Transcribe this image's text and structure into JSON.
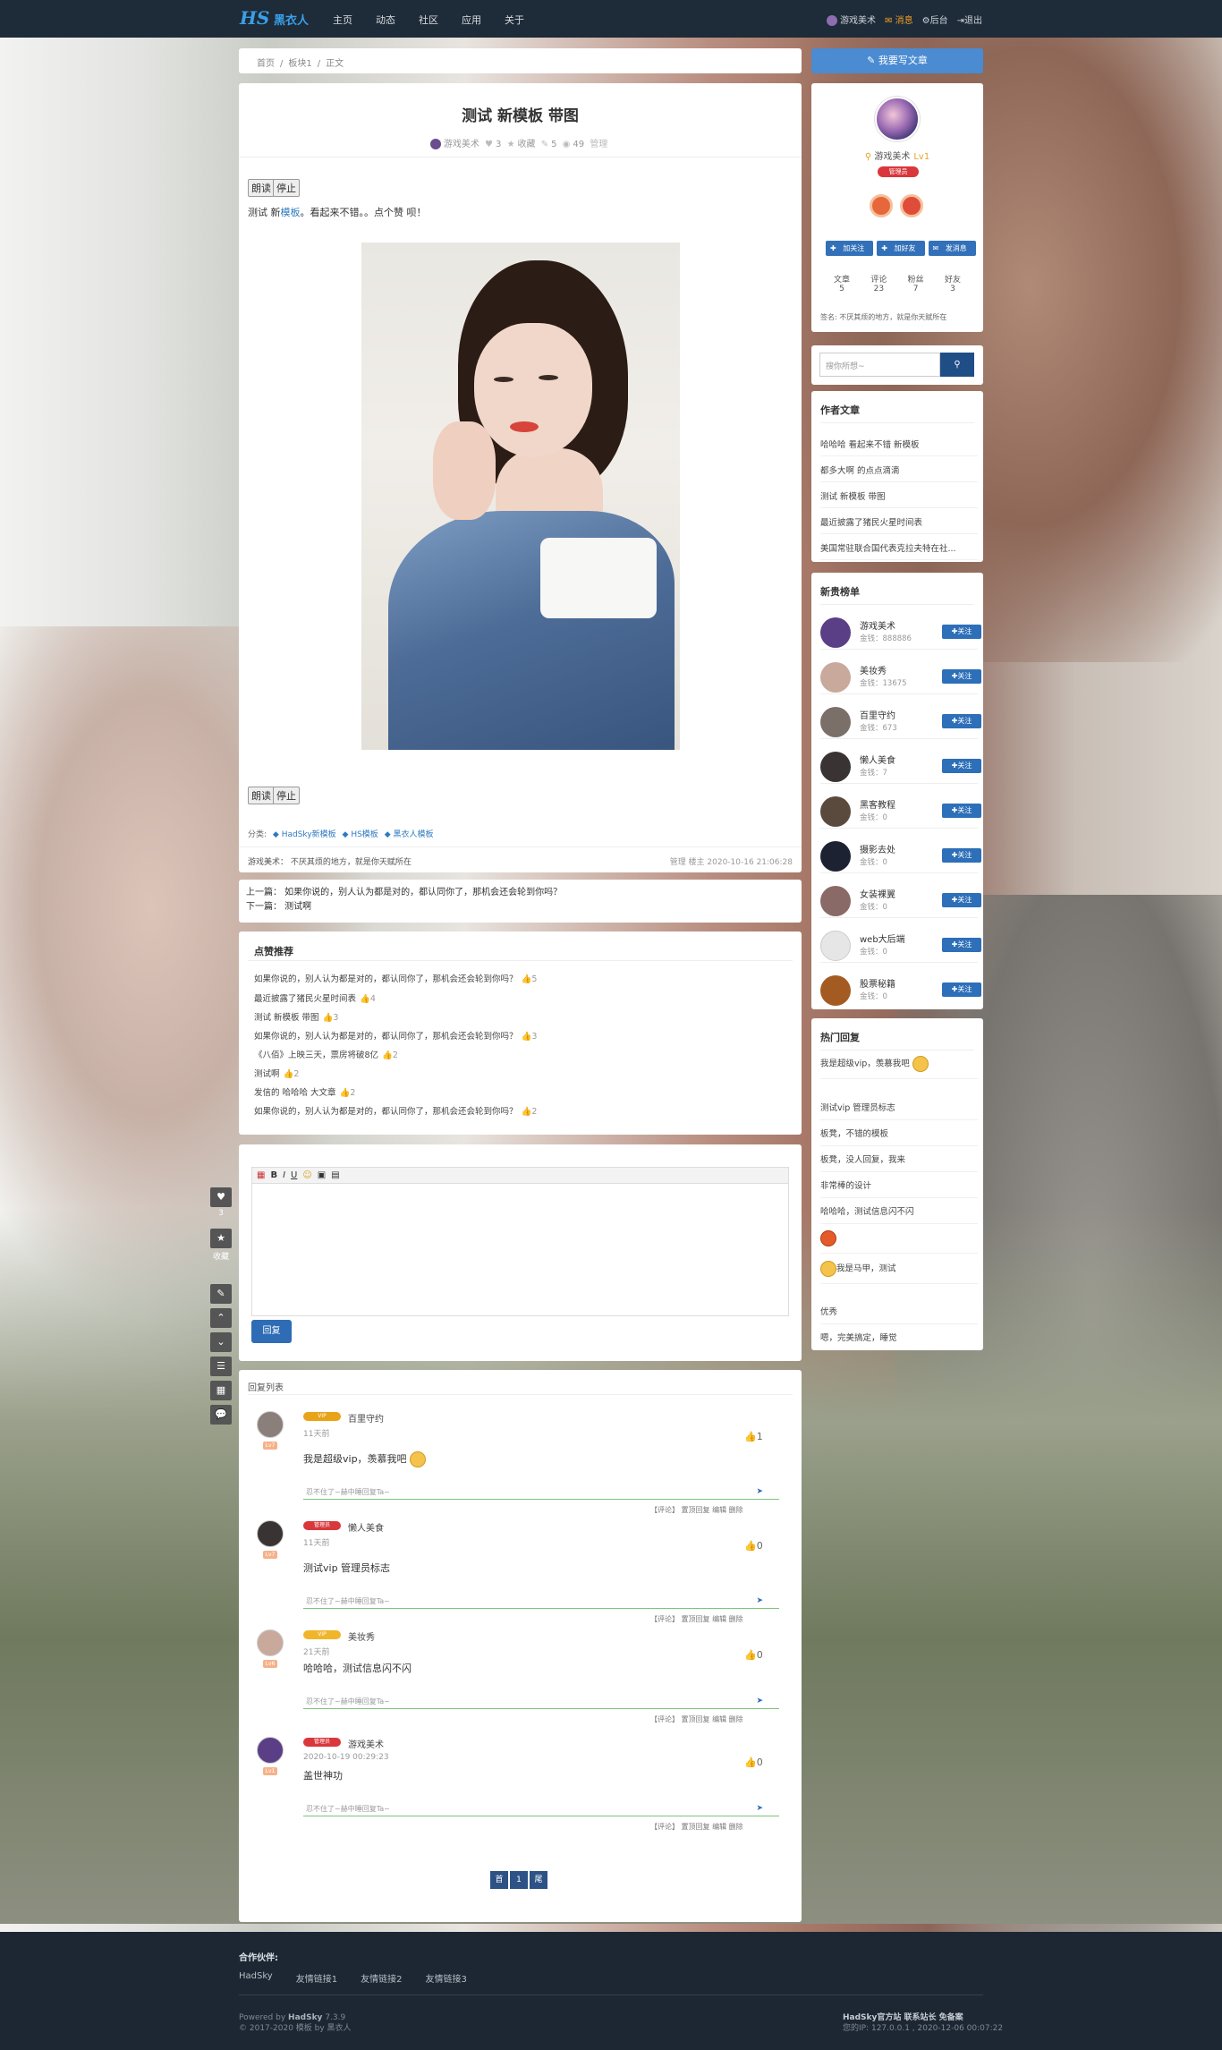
{
  "header": {
    "logo_mark": "HS",
    "logo_text": "黑衣人",
    "nav": [
      "主页",
      "动态",
      "社区",
      "应用",
      "关于"
    ],
    "user": "游戏美术",
    "messages": "消息",
    "admin": "后台",
    "logout": "退出"
  },
  "breadcrumb": [
    "首页",
    "/",
    "板块1",
    "/",
    "正文"
  ],
  "post": {
    "title": "测试 新模板 带图",
    "author": "游戏美术",
    "likes": "3",
    "collect_label": "收藏",
    "comments": "5",
    "views": "49",
    "manage": "管理",
    "read_btn": "朗读",
    "stop_btn": "停止",
    "body_prefix": "测试 新",
    "body_link": "模板",
    "body_suffix": "。看起来不错。。点个赞 呗！",
    "category_label": "分类:",
    "tags": [
      "HadSky新模板",
      "HS模板",
      "黑衣人模板"
    ],
    "signature": "游戏美术： 不厌其烦的地方，就是你天赋所在",
    "foot_right": "管理 楼主 2020-10-16 21:06:28"
  },
  "prevnext": {
    "prev": "上一篇： 如果你说的，别人认为都是对的，都认同你了，那机会还会轮到你吗？",
    "next": "下一篇： 测试啊"
  },
  "hot_recommend": {
    "title": "点赞推荐",
    "items": [
      {
        "text": "如果你说的，别人认为都是对的，都认同你了，那机会还会轮到你吗？",
        "likes": "5"
      },
      {
        "text": "最近披露了猪民火星时间表",
        "likes": "4"
      },
      {
        "text": "测试 新模板 带图",
        "likes": "3"
      },
      {
        "text": "如果你说的，别人认为都是对的，都认同你了，那机会还会轮到你吗？",
        "likes": "3"
      },
      {
        "text": "《八佰》上映三天，票房将破8亿",
        "likes": "2"
      },
      {
        "text": "测试啊",
        "likes": "2"
      },
      {
        "text": "发信的 哈哈哈 大文章",
        "likes": "2"
      },
      {
        "text": "如果你说的，别人认为都是对的，都认同你了，那机会还会轮到你吗？",
        "likes": "2"
      }
    ]
  },
  "editor": {
    "toolbar": [
      "B",
      "I",
      "U",
      "☺",
      "▣",
      "▤"
    ],
    "submit": "回复"
  },
  "replies": {
    "title": "回复列表",
    "input_placeholder": "忍不住了~赫中睡回复Ta~",
    "ops": "【评论】 置顶回复 编辑 删除",
    "items": [
      {
        "badge": "VIP",
        "name": "百里守约",
        "time": "11天前",
        "likes": "1",
        "content": "我是超级vip，羡慕我吧",
        "level": "Lv7"
      },
      {
        "badge": "管理员",
        "name": "懒人美食",
        "time": "11天前",
        "likes": "0",
        "content": "测试vip 管理员标志",
        "level": "Lv7"
      },
      {
        "badge": "VIP",
        "name": "美妆秀",
        "time": "21天前",
        "likes": "0",
        "content": "哈哈哈，测试信息闪不闪",
        "level": "Lv6"
      },
      {
        "badge": "管理员",
        "name": "游戏美术",
        "time": "2020-10-19 00:29:23",
        "likes": "0",
        "content": "盖世神功",
        "level": "Lv1"
      }
    ],
    "pager": [
      "首",
      "1",
      "尾"
    ]
  },
  "sidebar": {
    "write_btn": "我要写文章",
    "profile": {
      "name": "游戏美术",
      "level": "Lv1",
      "role": "管理员",
      "buttons": [
        "加关注",
        "加好友",
        "发消息"
      ],
      "stats": [
        {
          "label": "文章",
          "value": "5"
        },
        {
          "label": "评论",
          "value": "23"
        },
        {
          "label": "粉丝",
          "value": "7"
        },
        {
          "label": "好友",
          "value": "3"
        }
      ],
      "sign": "签名: 不厌其烦的地方，就是你天赋所在"
    },
    "search_placeholder": "搜你所想~",
    "author_posts": {
      "title": "作者文章",
      "items": [
        "哈哈哈 看起来不错 新模板",
        "都多大啊 的点点滴滴",
        "测试 新模板 带图",
        "最近披露了猪民火星时间表",
        "美国常驻联合国代表克拉夫特在社..."
      ]
    },
    "rich_list": {
      "title": "新贵榜单",
      "follow": "关注",
      "items": [
        {
          "name": "游戏美术",
          "coins": "金钱：888886",
          "color": "#5a3f86"
        },
        {
          "name": "美妆秀",
          "coins": "金钱：13675",
          "color": "#c8a99c"
        },
        {
          "name": "百里守约",
          "coins": "金钱：673",
          "color": "#7b6f6a"
        },
        {
          "name": "懒人美食",
          "coins": "金钱：7",
          "color": "#3a3333"
        },
        {
          "name": "黑客教程",
          "coins": "金钱：0",
          "color": "#5a4a3e"
        },
        {
          "name": "摄影去处",
          "coins": "金钱：0",
          "color": "#1d2233"
        },
        {
          "name": "女装裸翼",
          "coins": "金钱：0",
          "color": "#8a6a66"
        },
        {
          "name": "web大后端",
          "coins": "金钱：0",
          "color": "#e6e6e6"
        },
        {
          "name": "股票秘籍",
          "coins": "金钱：0",
          "color": "#a45b22"
        }
      ]
    },
    "hot_replies": {
      "title": "热门回复",
      "items": [
        "我是超级vip，羡慕我吧",
        "测试vip 管理员标志",
        "板凳，不错的模板",
        "板凳，没人回复，我来",
        "非常棒的设计",
        "哈哈哈，测试信息闪不闪",
        "",
        "我是马甲，测试",
        "优秀",
        "嗯，完美搞定，睡觉"
      ]
    }
  },
  "sidefloat": {
    "likes": "3",
    "collect": "收藏"
  },
  "footer": {
    "partner_title": "合作伙伴:",
    "links": [
      "HadSky",
      "友情链接1",
      "友情链接2",
      "友情链接3"
    ],
    "powered_prefix": "Powered by",
    "powered_name": "HadSky",
    "powered_version": "7.3.9",
    "copyright": "© 2017-2020 模板 by 黑衣人",
    "right_title": "HadSky官方站 联系站长 免备案",
    "right_info": "您的IP: 127.0.0.1 , 2020-12-06 00:07:22"
  }
}
